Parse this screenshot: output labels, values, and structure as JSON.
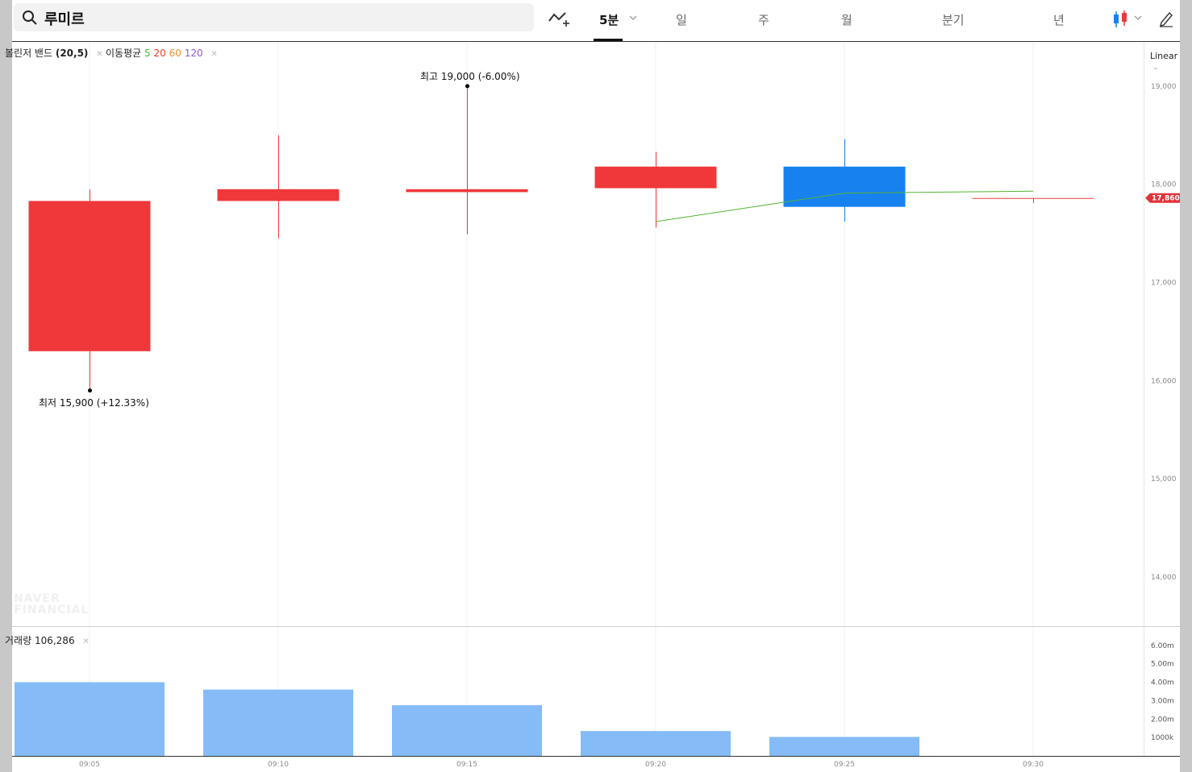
{
  "search": {
    "value": "루미르"
  },
  "toolbar": {
    "periods": [
      "5분",
      "일",
      "주",
      "월",
      "분기",
      "년"
    ],
    "active_period": "5분",
    "icons": [
      "add-indicator-icon",
      "chevron-down-icon",
      "candlestick-type-icon",
      "chevron-down-icon",
      "draw-pencil-icon",
      "search-icon"
    ]
  },
  "legend": {
    "bollinger_name": "볼린저 밴드",
    "bollinger_params": "(20,5)",
    "ma_name": "이동평균",
    "ma_periods": [
      "5",
      "20",
      "60",
      "120"
    ],
    "ma_colors": [
      "#52b534",
      "#e8392f",
      "#f19135",
      "#8e5bd1"
    ],
    "volume_name": "거래량",
    "volume_value": "106,286",
    "close_icon": "close-icon"
  },
  "scale_mode": "Linear",
  "colors": {
    "up": "#f0383b",
    "down": "#1781f0",
    "ma5": "#52b534",
    "volume": "#85bcf8",
    "price_tag": "#e0333a"
  },
  "annotations": {
    "high": "최고 19,000 (-6.00%)",
    "low": "최저 15,900 (+12.33%)"
  },
  "watermark": [
    "NAVER",
    "FINANCIAL"
  ],
  "chart_data": {
    "type": "candlestick",
    "x": [
      "09:05",
      "09:10",
      "09:15",
      "09:20",
      "09:25",
      "09:30"
    ],
    "candles": [
      {
        "open": 16300,
        "high": 17950,
        "low": 15900,
        "close": 17830
      },
      {
        "open": 17830,
        "high": 18500,
        "low": 17450,
        "close": 17950
      },
      {
        "open": 17920,
        "high": 19000,
        "low": 17490,
        "close": 17950
      },
      {
        "open": 17960,
        "high": 18330,
        "low": 17560,
        "close": 18180
      },
      {
        "open": 18180,
        "high": 18460,
        "low": 17620,
        "close": 17770
      },
      {
        "open": 17860,
        "high": 17860,
        "low": 17810,
        "close": 17860
      }
    ],
    "ma5": [
      null,
      null,
      null,
      17620,
      17910,
      17930
    ],
    "price_ylim": [
      13500,
      19450
    ],
    "price_ticks": [
      14000,
      15000,
      16000,
      17000,
      18000,
      19000
    ],
    "price_tick_labels": [
      "14,000",
      "15,000",
      "16,000",
      "17,000",
      "18,000",
      "19,000"
    ],
    "current_price": 17860,
    "current_price_label": "17,860",
    "volume": [
      4000000,
      3600000,
      2750000,
      1350000,
      1030000,
      0
    ],
    "volume_ylim": [
      0,
      7000000
    ],
    "volume_ticks": [
      1000000,
      2000000,
      3000000,
      4000000,
      5000000,
      6000000
    ],
    "volume_tick_labels": [
      "1000k",
      "2.00m",
      "3.00m",
      "4.00m",
      "5.00m",
      "6.00m"
    ]
  }
}
